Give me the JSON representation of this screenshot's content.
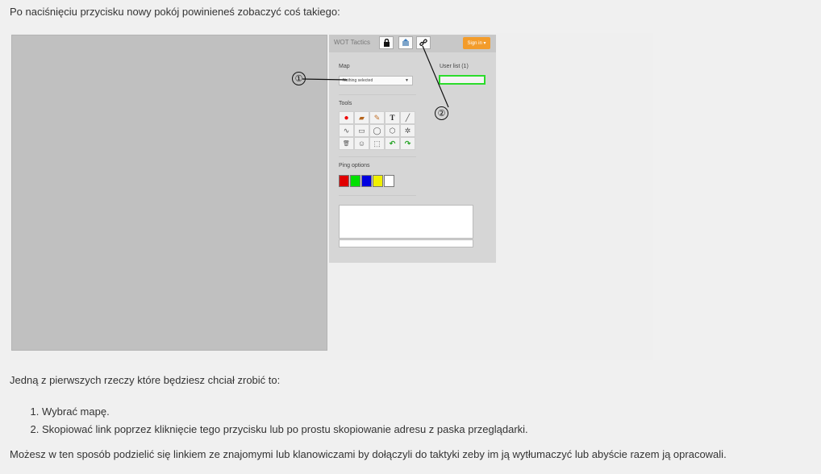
{
  "intro": "Po naciśnięciu przycisku nowy pokój powinieneś zobaczyć coś takiego:",
  "app": {
    "title": "WOT Tactics",
    "toolbar": {
      "lock_icon": "lock-icon",
      "upload_icon": "upload-icon",
      "link_icon": "link-icon",
      "signin_label": "Sign in ▾"
    },
    "map_label": "Map",
    "map_selected": "Nothing selected",
    "userlist_label": "User list (1)",
    "tools_label": "Tools",
    "tools": [
      "●",
      "▰",
      "✎",
      "T",
      "╱",
      "∿",
      "▭",
      "◯",
      "⬡",
      "✲",
      "🗑",
      "☺",
      "⬚",
      "↶",
      "↷"
    ],
    "ping_label": "Ping options",
    "ping_colors": [
      "#e00000",
      "#00e000",
      "#0000e0",
      "#f0f000",
      "#ffffff"
    ],
    "callouts": [
      "①",
      "②"
    ]
  },
  "first": "Jedną z pierwszych rzeczy które będziesz chciał zrobić to:",
  "steps": [
    "Wybrać mapę.",
    "Skopiować link poprzez kliknięcie tego przycisku lub po prostu skopiowanie adresu z paska przeglądarki."
  ],
  "closing": "Możesz w ten sposób podzielić się linkiem ze znajomymi lub klanowiczami by dołączyli do taktyki zeby im ją wytłumaczyć lub abyście razem ją opracowali."
}
